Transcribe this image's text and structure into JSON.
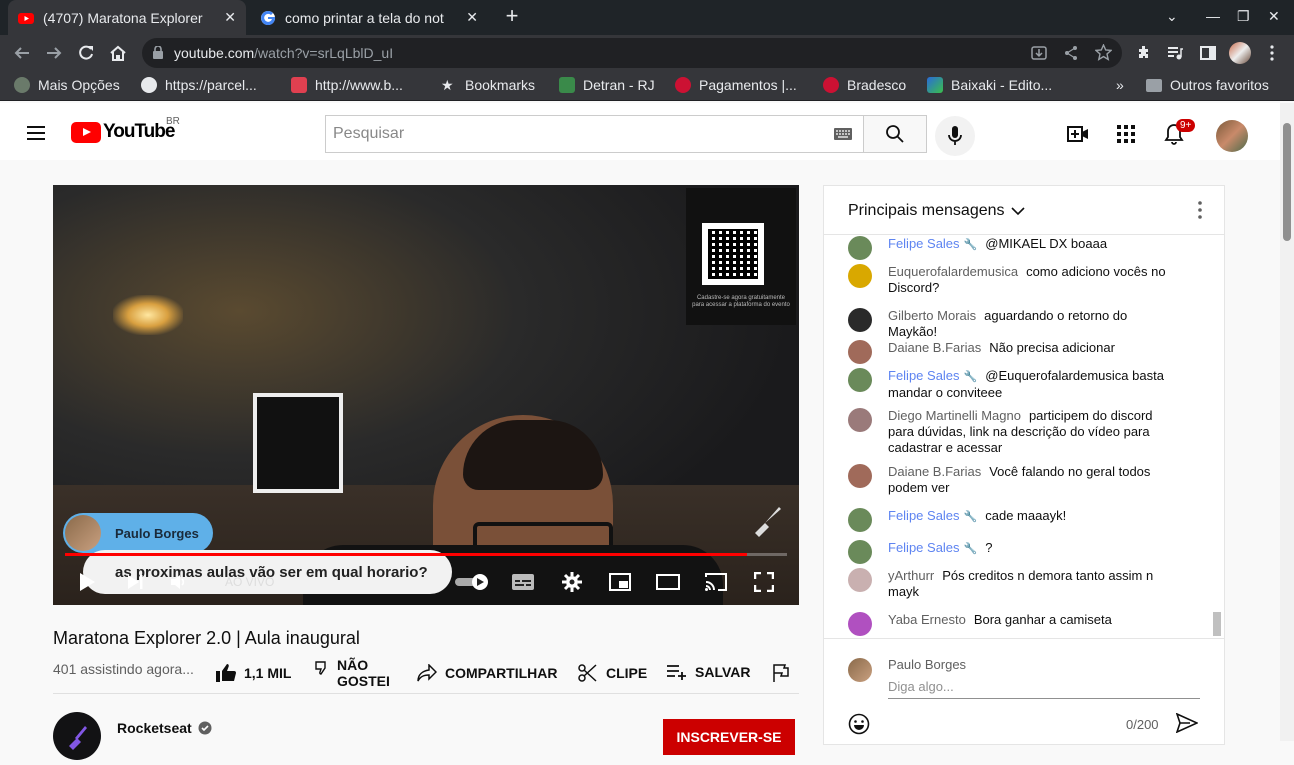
{
  "browser": {
    "tabs": [
      {
        "title": "(4707) Maratona Explorer",
        "active": true
      },
      {
        "title": "como printar a tela do not",
        "active": false
      }
    ],
    "url_host": "youtube.com",
    "url_path": "/watch?v=srLqLblD_uI",
    "bookmarks": [
      "Mais Opções",
      "https://parcel...",
      "http://www.b...",
      "Bookmarks",
      "Detran - RJ",
      "Pagamentos |...",
      "Bradesco",
      "Baixaki - Edito..."
    ],
    "more_bookmarks": "»",
    "other_favorites": "Outros favoritos"
  },
  "youtube": {
    "logo_text": "YouTube",
    "country_code": "BR",
    "search_placeholder": "Pesquisar",
    "notification_count": "9+"
  },
  "player": {
    "qr_caption": "Cadastre-se agora gratuitamente para acessar a plataforma do evento",
    "overlay_name": "Paulo Borges",
    "overlay_question": "as proximas aulas vão ser em qual horario?",
    "live_label": "AO VIVO",
    "progress_fraction": 0.945
  },
  "video": {
    "title": "Maratona Explorer 2.0 | Aula inaugural",
    "views": "401 assistindo agora...",
    "like_count": "1,1 MIL",
    "dislike_label_1": "NÃO",
    "dislike_label_2": "GOSTEI",
    "share_label": "COMPARTILHAR",
    "clip_label": "CLIPE",
    "save_label": "SALVAR",
    "channel_name": "Rocketseat",
    "subscribe_label": "INSCREVER-SE"
  },
  "chat": {
    "header": "Principais mensagens",
    "messages": [
      {
        "author": "Felipe Sales",
        "mod": true,
        "text": "@MIKAEL DX boaaa",
        "avatar_color": "#6a8a5a"
      },
      {
        "author": "Euquerofalardemusica",
        "mod": false,
        "text": "como adiciono vocês no Discord?",
        "avatar_color": "#d9a800"
      },
      {
        "author": "Gilberto Morais",
        "mod": false,
        "text": "aguardando o retorno do Maykão!",
        "avatar_color": "#2a2a2a"
      },
      {
        "author": "Daiane B.Farias",
        "mod": false,
        "text": "Não precisa adicionar",
        "avatar_color": "#a06a5a"
      },
      {
        "author": "Felipe Sales",
        "mod": true,
        "text": "@Euquerofalardemusica basta mandar o conviteee",
        "avatar_color": "#6a8a5a"
      },
      {
        "author": "Diego Martinelli Magno",
        "mod": false,
        "text": "participem do discord para dúvidas, link na descrição do vídeo para cadastrar e acessar",
        "avatar_color": "#9a7a7a"
      },
      {
        "author": "Daiane B.Farias",
        "mod": false,
        "text": "Você falando no geral todos podem ver",
        "avatar_color": "#a06a5a"
      },
      {
        "author": "Felipe Sales",
        "mod": true,
        "text": "cade maaayk!",
        "avatar_color": "#6a8a5a"
      },
      {
        "author": "Felipe Sales",
        "mod": true,
        "text": "?",
        "avatar_color": "#6a8a5a"
      },
      {
        "author": "yArthurr",
        "mod": false,
        "text": "Pós creditos n demora tanto assim n mayk",
        "avatar_color": "#c9b0b0"
      },
      {
        "author": "Yaba Ernesto",
        "mod": false,
        "text": "Bora ganhar a camiseta",
        "avatar_color": "#b050c0"
      }
    ],
    "input_name": "Paulo Borges",
    "input_placeholder": "Diga algo...",
    "char_count": "0/200"
  }
}
